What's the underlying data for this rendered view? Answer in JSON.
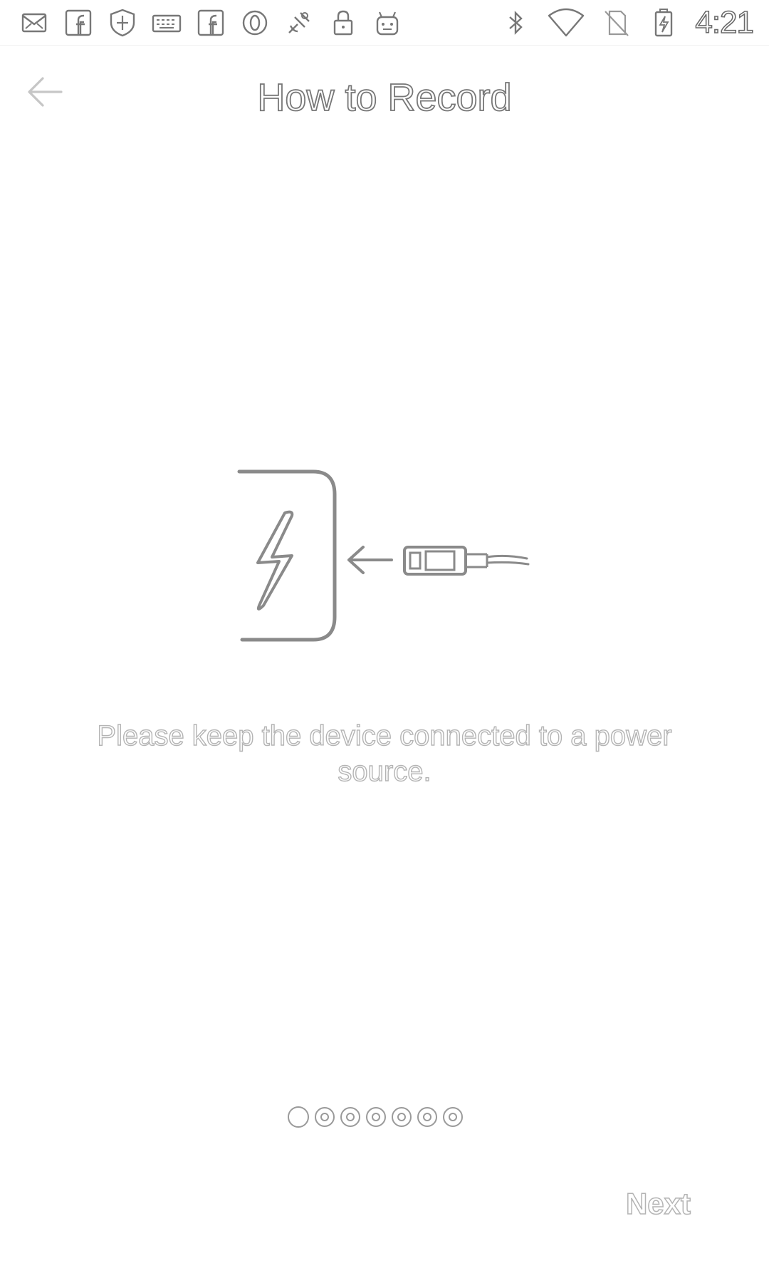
{
  "status_bar": {
    "time": "4:21",
    "left_icons": [
      "mail-icon",
      "facebook-icon",
      "shield-icon",
      "keyboard-icon",
      "facebook-icon",
      "opera-icon",
      "satellite-icon",
      "lock-icon",
      "android-icon"
    ],
    "right_icons": [
      "bluetooth-icon",
      "wifi-icon",
      "no-sim-icon",
      "battery-charging-icon"
    ]
  },
  "header": {
    "title": "How to Record",
    "back_icon": "arrow-left-icon"
  },
  "main": {
    "illustration": "device-charging-icon",
    "instruction": "Please keep the device connected to a power source."
  },
  "pager": {
    "total": 7,
    "current_index": 0
  },
  "footer": {
    "next_label": "Next"
  },
  "colors": {
    "background": "#ffffff",
    "outline": "#7a7a7a",
    "muted_text": "#b4b4b4"
  }
}
